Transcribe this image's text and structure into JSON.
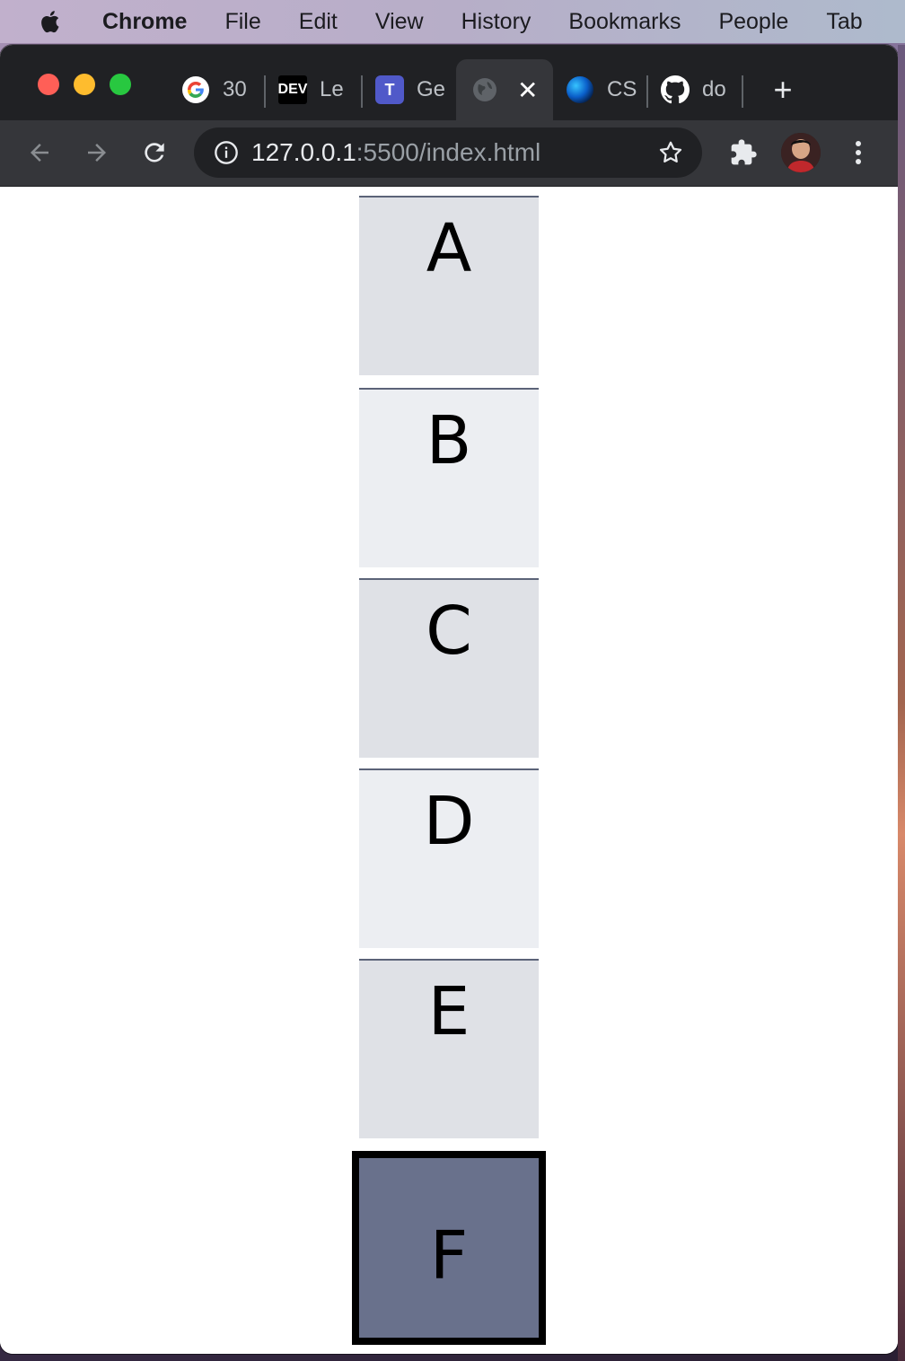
{
  "menubar": {
    "app_name": "Chrome",
    "items": [
      "File",
      "Edit",
      "View",
      "History",
      "Bookmarks",
      "People",
      "Tab"
    ]
  },
  "tabs": [
    {
      "title": "30",
      "icon": "google-icon"
    },
    {
      "title": "Le",
      "icon": "dev-icon",
      "badge": "DEV"
    },
    {
      "title": "Ge",
      "icon": "teams-icon",
      "badge": "T"
    },
    {
      "title": "",
      "icon": "globe-icon",
      "active": true,
      "close": "✕"
    },
    {
      "title": "CS",
      "icon": "blue-orb-icon"
    },
    {
      "title": "do",
      "icon": "github-icon"
    }
  ],
  "new_tab_label": "+",
  "address_bar": {
    "host": "127.0.0.1",
    "path": ":5500/index.html"
  },
  "boxes": [
    {
      "label": "A"
    },
    {
      "label": "B"
    },
    {
      "label": "C"
    },
    {
      "label": "D"
    },
    {
      "label": "E"
    },
    {
      "label": "F",
      "selected": true
    }
  ],
  "colors": {
    "box_odd": "#dfe1e6",
    "box_even": "#eceef2",
    "box_selected": "#69718c",
    "tabstrip": "#202124",
    "toolbar": "#35363a"
  }
}
